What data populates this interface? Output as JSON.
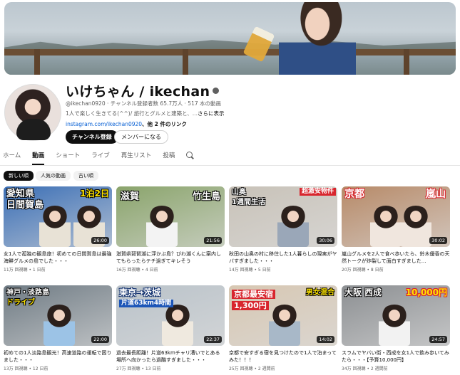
{
  "channel": {
    "name": "いけちゃん / ikechan",
    "handle": "@ikechan0920",
    "subscribers": "チャンネル登録者数 65.7万人",
    "video_count": "517 本の動画",
    "description": "1人で楽しく生きてる(^^)/ 旅行とグルメと建築と、...",
    "description_more": "さらに表示",
    "link_url": "instagram.com/ikechan0920",
    "link_more": "、他 2 件のリンク",
    "subscribe_label": "チャンネル登録",
    "join_label": "メンバーになる"
  },
  "tabs": [
    {
      "label": "ホーム",
      "active": false
    },
    {
      "label": "動画",
      "active": true
    },
    {
      "label": "ショート",
      "active": false
    },
    {
      "label": "ライブ",
      "active": false
    },
    {
      "label": "再生リスト",
      "active": false
    },
    {
      "label": "投稿",
      "active": false
    }
  ],
  "filters": [
    {
      "label": "新しい順",
      "active": true
    },
    {
      "label": "人気の動画",
      "active": false
    },
    {
      "label": "古い順",
      "active": false
    }
  ],
  "videos": [
    {
      "overlay1": "愛知県",
      "overlay2": "日間賀島",
      "overlay3": "1泊2日",
      "duration": "26:00",
      "title": "女1人で孤独の観島旅！初めての日間賀島は最強海鮮グルメの島でした・・・",
      "views": "11万 回視聴",
      "age": "1 日前",
      "bg": "#3b6fb6",
      "shirt": "#e8e2d6"
    },
    {
      "overlay1": "滋賀",
      "overlay2": "竹生島",
      "overlay3": "",
      "duration": "21:56",
      "title": "滋賀県琵琶湖に浮かぶ島？びわ湖くんに案内してもらったらテチ過ぎてキレそう",
      "views": "16万 回視聴",
      "age": "4 日前",
      "bg": "#8aa46b",
      "shirt": "#f3f3f3"
    },
    {
      "overlay1": "山奥",
      "overlay2": "1週間生活",
      "overlay3": "超激安物件",
      "duration": "30:06",
      "title": "秋田の山奥の村に移住した1人暮らしの現実がヤバすぎました・・・",
      "views": "14万 回視聴",
      "age": "5 日前",
      "bg": "#c8c2b8",
      "shirt": "#9aa7b8"
    },
    {
      "overlay1": "京都",
      "overlay2": "嵐山",
      "overlay3": "",
      "duration": "30:02",
      "title": "嵐山グルメを2人で食べ歩いたら、鈴木優香の天然トークが炸裂して面白すぎました...",
      "views": "20万 回視聴",
      "age": "8 日前",
      "bg": "#b78a68",
      "shirt": "#f0e6de"
    },
    {
      "overlay1": "神戸・淡路島",
      "overlay2": "ドライブ",
      "overlay3": "",
      "duration": "22:00",
      "title": "初めての1人淡路島観光！高速道路の運転で困りました・・・",
      "views": "13万 回視聴",
      "age": "12 日前",
      "bg": "#6f7b84",
      "shirt": "#9cc3e6"
    },
    {
      "overlay1": "東京→茨城",
      "overlay2": "片道63km4時間",
      "overlay3": "",
      "duration": "22:37",
      "title": "過去最長距離！片道63kmチャリ漕いでとある場所へ向かったら過酷すぎました・・・",
      "views": "27万 回視聴",
      "age": "13 日前",
      "bg": "#b9c2c9",
      "shirt": "#efe9df"
    },
    {
      "overlay1": "京都最安宿",
      "overlay2": "1,300円",
      "overlay3": "男女混合",
      "duration": "14:02",
      "title": "京都で安すぎる宿を見つけたので1人で泊まってみた！！！",
      "views": "25万 回視聴",
      "age": "2 週間前",
      "bg": "#d7c7b2",
      "shirt": "#a8b8c8"
    },
    {
      "overlay1": "大阪 西成",
      "overlay2": "10,000円",
      "overlay3": "",
      "duration": "24:57",
      "title": "スラムでヤバい街・西成を女1人で飲み歩いてみたら・・・【予算10,000円】",
      "views": "34万 回視聴",
      "age": "2 週間前",
      "bg": "#8c8f92",
      "shirt": "#f2f2f2"
    }
  ],
  "colors": {
    "overlay_yellow": "#ffe500",
    "overlay_white": "#ffffff",
    "overlay_red": "#d8262e",
    "link_blue": "#065fd4"
  }
}
